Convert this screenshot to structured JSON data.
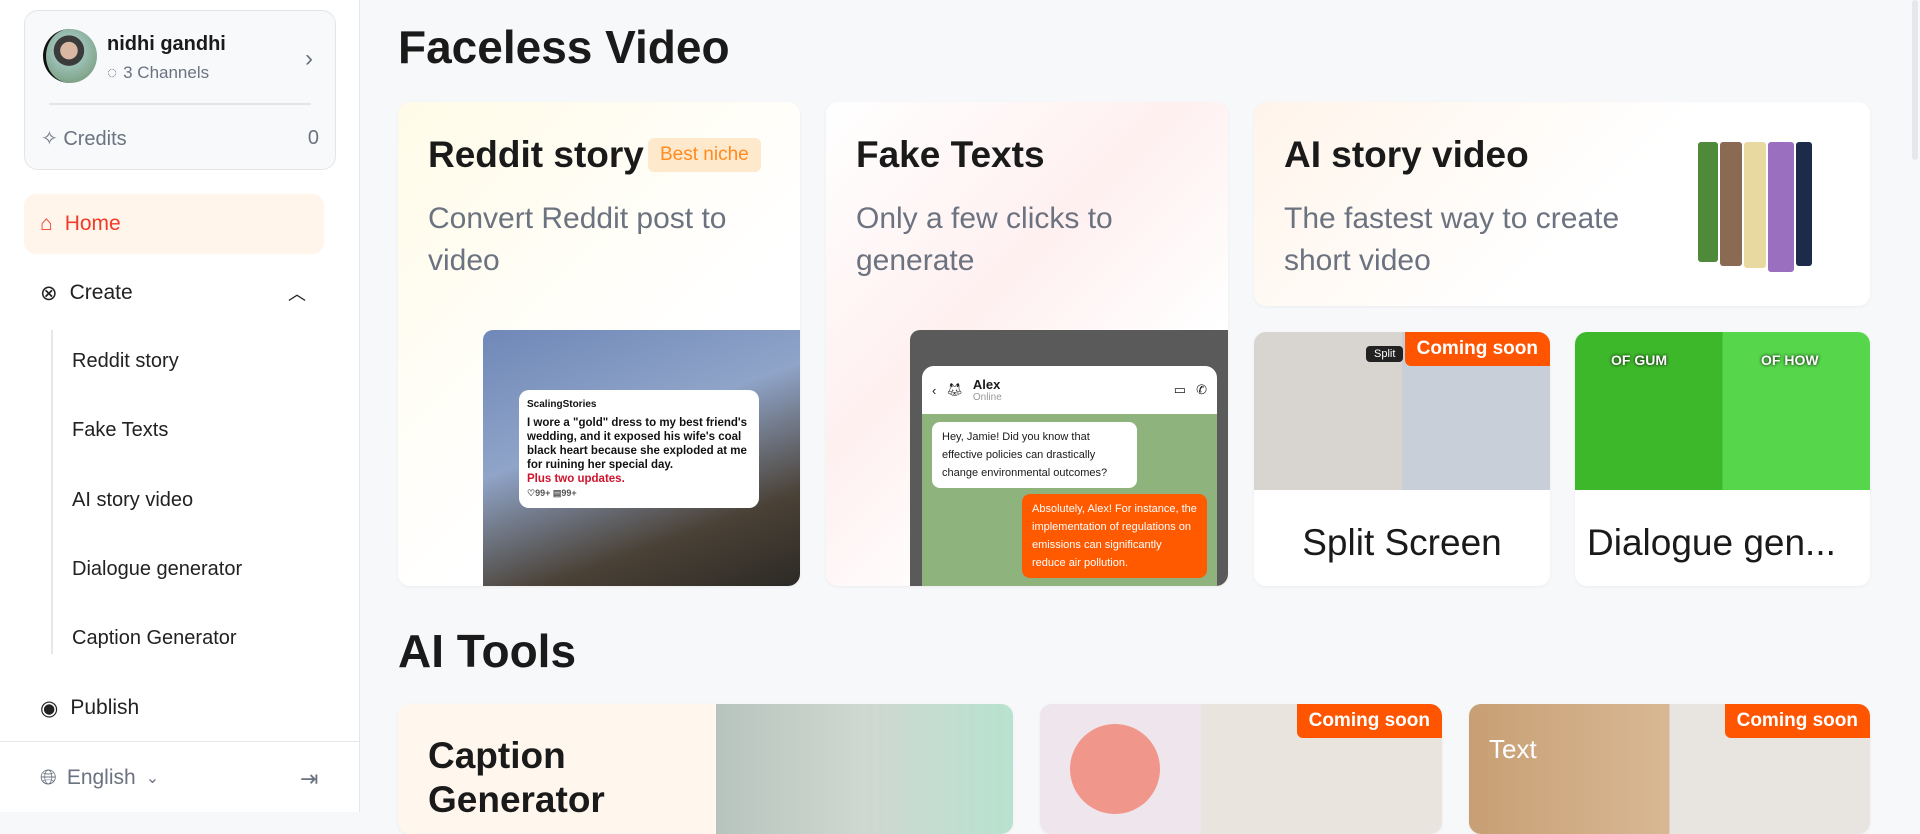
{
  "profile": {
    "name": "nidhi gandhi",
    "channels": "3 Channels",
    "credits_label": "Credits",
    "credits_value": "0"
  },
  "nav": {
    "home": "Home",
    "create": "Create",
    "sub": [
      "Reddit story",
      "Fake Texts",
      "AI story video",
      "Dialogue generator",
      "Caption Generator"
    ],
    "publish": "Publish"
  },
  "footer": {
    "language": "English"
  },
  "colors": {
    "accent": "#ff5500",
    "active": "#f23a2a"
  },
  "faceless": {
    "title": "Faceless Video",
    "reddit": {
      "title": "Reddit story",
      "badge": "Best niche",
      "subtitle": "Convert Reddit post to video",
      "post": {
        "user": "ScalingStories",
        "text": "I wore a \"gold\" dress to my best friend's wedding, and it exposed his wife's coal black heart because she exploded at me for ruining her special day.",
        "highlight": "Plus two updates.",
        "likes": "99+",
        "comments": "99+"
      }
    },
    "fake": {
      "title": "Fake Texts",
      "subtitle": "Only a few clicks to generate",
      "chat": {
        "name": "Alex",
        "status": "Online",
        "msg1": "Hey, Jamie! Did you know that effective policies can drastically change environmental outcomes?",
        "msg2": "Absolutely, Alex! For instance, the implementation of regulations on emissions can significantly reduce air pollution."
      }
    },
    "ai": {
      "title": "AI story video",
      "subtitle": "The fastest way to create short video"
    },
    "split": {
      "title": "Split Screen",
      "badge": "Coming soon",
      "tag": "Split"
    },
    "dialogue": {
      "title": "Dialogue gen...",
      "left_caption": "OF GUM",
      "right_caption": "OF HOW"
    }
  },
  "tools": {
    "title": "AI Tools",
    "caption": {
      "title": "Caption Generator"
    },
    "second": {
      "badge": "Coming soon"
    },
    "third": {
      "badge": "Coming soon",
      "label": "Text"
    }
  }
}
